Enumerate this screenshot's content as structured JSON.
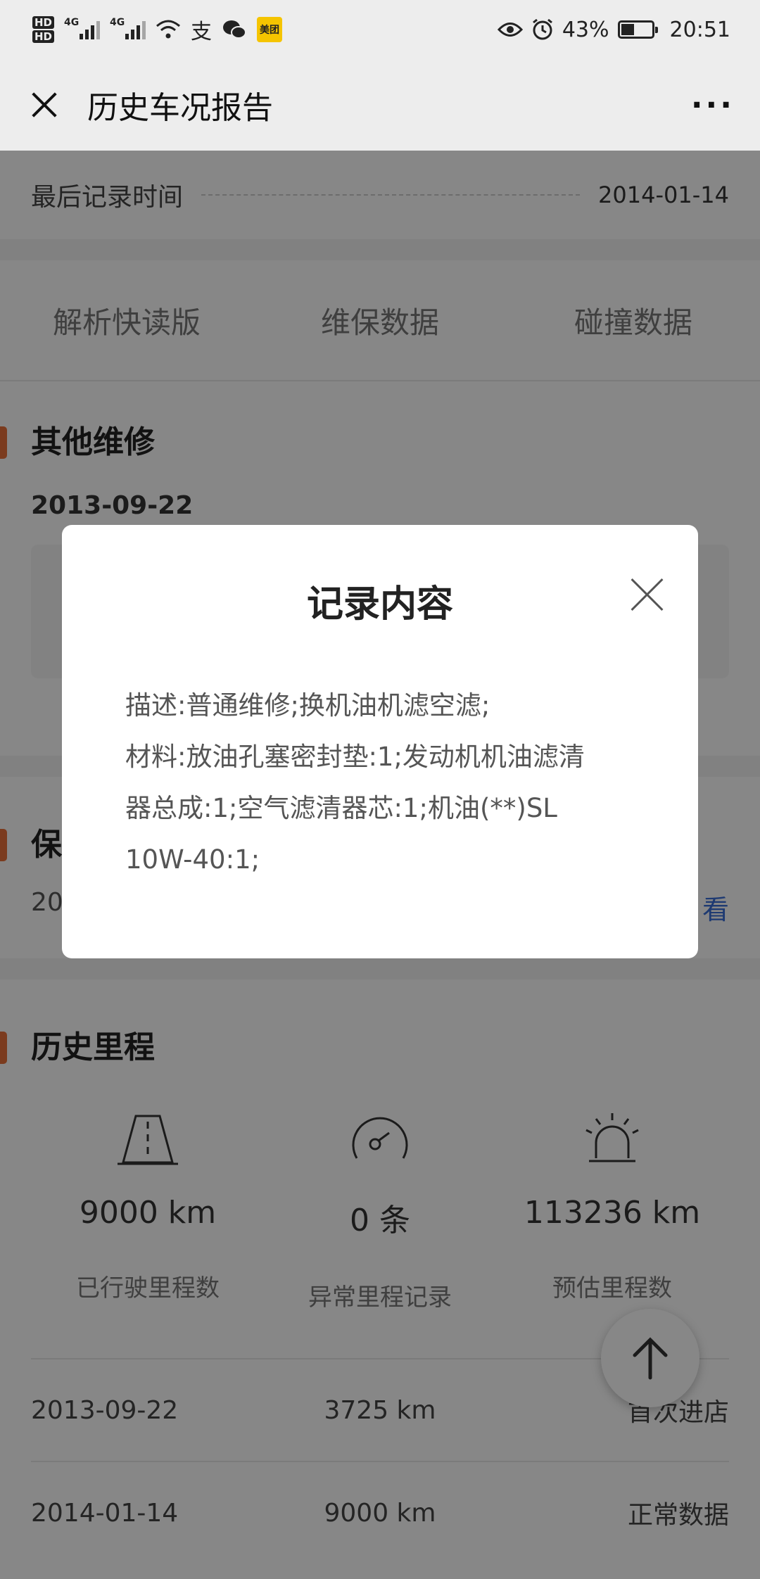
{
  "status_bar": {
    "hd1": "HD",
    "hd2": "HD",
    "net1": "4G",
    "net2": "4G",
    "app_icon_label": "美团",
    "battery": "43%",
    "battery_level": 0.43,
    "time": "20:51"
  },
  "titlebar": {
    "title": "历史车况报告",
    "more": "···"
  },
  "last_record": {
    "label": "最后记录时间",
    "value": "2014-01-14"
  },
  "tabs": [
    "解析快读版",
    "维保数据",
    "碰撞数据"
  ],
  "other_repair": {
    "title": "其他维修",
    "date": "2013-09-22"
  },
  "maintenance": {
    "title_visible": "保",
    "date_visible": "20",
    "view_visible": "看"
  },
  "mileage": {
    "title": "历史里程",
    "stats": [
      {
        "value": "9000 km",
        "label": "已行驶里程数",
        "icon": "road-icon"
      },
      {
        "value": "0 条",
        "label": "异常里程记录",
        "icon": "gauge-icon"
      },
      {
        "value": "113236 km",
        "label": "预估里程数",
        "icon": "alarm-light-icon"
      }
    ],
    "rows": [
      {
        "date": "2013-09-22",
        "km": "3725 km",
        "note": "首次进店"
      },
      {
        "date": "2014-01-14",
        "km": "9000 km",
        "note": "正常数据"
      }
    ]
  },
  "dialog": {
    "title": "记录内容",
    "lines": [
      "描述:普通维修;换机油机滤空滤;",
      "材料:放油孔塞密封垫:1;发动机机油滤清",
      "器总成:1;空气滤清器芯:1;机油(**)SL",
      "10W-40:1;"
    ]
  },
  "colors": {
    "accent": "#e8703a",
    "link": "#3a6fd8",
    "overlay": "rgba(0,0,0,0.47)"
  }
}
